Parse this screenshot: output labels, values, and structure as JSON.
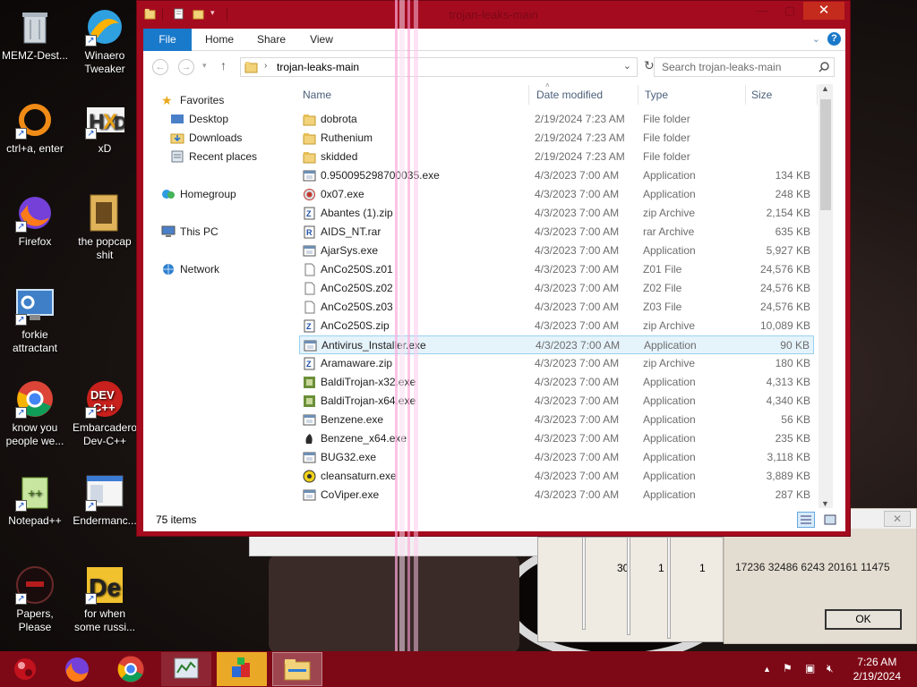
{
  "desktop": {
    "icons": [
      {
        "label": "MEMZ-Dest...",
        "icon": "recycle-bin-icon"
      },
      {
        "label": "Winaero Tweaker",
        "icon": "winaero-icon"
      },
      {
        "label": "ctrl+a, enter",
        "icon": "ring-icon"
      },
      {
        "label": "xD",
        "icon": "hxd-icon"
      },
      {
        "label": "Firefox",
        "icon": "firefox-icon"
      },
      {
        "label": "the popcap shit",
        "icon": "folder-icon"
      },
      {
        "label": "forkie attractant",
        "icon": "monitor-icon"
      },
      {
        "label": "know you people we...",
        "icon": "chrome-icon"
      },
      {
        "label": "Embarcadero Dev-C++",
        "icon": "devcpp-icon"
      },
      {
        "label": "Notepad++",
        "icon": "notepadpp-icon"
      },
      {
        "label": "Endermanc...",
        "icon": "window-icon"
      },
      {
        "label": "Papers, Please",
        "icon": "papers-please-icon"
      },
      {
        "label": "for when some russi...",
        "icon": "de-icon"
      }
    ]
  },
  "explorer": {
    "title": "trojan-leaks-main",
    "ribbon_tabs": [
      "File",
      "Home",
      "Share",
      "View"
    ],
    "address": "trojan-leaks-main",
    "search_placeholder": "Search trojan-leaks-main",
    "nav": {
      "favorites": "Favorites",
      "favorites_items": [
        "Desktop",
        "Downloads",
        "Recent places"
      ],
      "homegroup": "Homegroup",
      "this_pc": "This PC",
      "network": "Network"
    },
    "columns": {
      "name": "Name",
      "date": "Date modified",
      "type": "Type",
      "size": "Size"
    },
    "files": [
      {
        "name": "dobrota",
        "date": "2/19/2024 7:23 AM",
        "type": "File folder",
        "size": "",
        "icon": "folder-icon"
      },
      {
        "name": "Ruthenium",
        "date": "2/19/2024 7:23 AM",
        "type": "File folder",
        "size": "",
        "icon": "folder-icon"
      },
      {
        "name": "skidded",
        "date": "2/19/2024 7:23 AM",
        "type": "File folder",
        "size": "",
        "icon": "folder-icon"
      },
      {
        "name": "0.950095298700035.exe",
        "date": "4/3/2023 7:00 AM",
        "type": "Application",
        "size": "134 KB",
        "icon": "exe-icon"
      },
      {
        "name": "0x07.exe",
        "date": "4/3/2023 7:00 AM",
        "type": "Application",
        "size": "248 KB",
        "icon": "exe-red-icon"
      },
      {
        "name": "Abantes (1).zip",
        "date": "4/3/2023 7:00 AM",
        "type": "zip Archive",
        "size": "2,154 KB",
        "icon": "zip-icon"
      },
      {
        "name": "AIDS_NT.rar",
        "date": "4/3/2023 7:00 AM",
        "type": "rar Archive",
        "size": "635 KB",
        "icon": "rar-icon"
      },
      {
        "name": "AjarSys.exe",
        "date": "4/3/2023 7:00 AM",
        "type": "Application",
        "size": "5,927 KB",
        "icon": "exe-icon"
      },
      {
        "name": "AnCo250S.z01",
        "date": "4/3/2023 7:00 AM",
        "type": "Z01 File",
        "size": "24,576 KB",
        "icon": "blank-file-icon"
      },
      {
        "name": "AnCo250S.z02",
        "date": "4/3/2023 7:00 AM",
        "type": "Z02 File",
        "size": "24,576 KB",
        "icon": "blank-file-icon"
      },
      {
        "name": "AnCo250S.z03",
        "date": "4/3/2023 7:00 AM",
        "type": "Z03 File",
        "size": "24,576 KB",
        "icon": "blank-file-icon"
      },
      {
        "name": "AnCo250S.zip",
        "date": "4/3/2023 7:00 AM",
        "type": "zip Archive",
        "size": "10,089 KB",
        "icon": "zip-icon"
      },
      {
        "name": "Antivirus_Installer.exe",
        "date": "4/3/2023 7:00 AM",
        "type": "Application",
        "size": "90 KB",
        "icon": "exe-icon"
      },
      {
        "name": "Aramaware.zip",
        "date": "4/3/2023 7:00 AM",
        "type": "zip Archive",
        "size": "180 KB",
        "icon": "zip-icon"
      },
      {
        "name": "BaldiTrojan-x32.exe",
        "date": "4/3/2023 7:00 AM",
        "type": "Application",
        "size": "4,313 KB",
        "icon": "exe-green-icon"
      },
      {
        "name": "BaldiTrojan-x64.exe",
        "date": "4/3/2023 7:00 AM",
        "type": "Application",
        "size": "4,340 KB",
        "icon": "exe-green-icon"
      },
      {
        "name": "Benzene.exe",
        "date": "4/3/2023 7:00 AM",
        "type": "Application",
        "size": "56 KB",
        "icon": "exe-icon"
      },
      {
        "name": "Benzene_x64.exe",
        "date": "4/3/2023 7:00 AM",
        "type": "Application",
        "size": "235 KB",
        "icon": "exe-dark-icon"
      },
      {
        "name": "BUG32.exe",
        "date": "4/3/2023 7:00 AM",
        "type": "Application",
        "size": "3,118 KB",
        "icon": "exe-icon"
      },
      {
        "name": "cleansaturn.exe",
        "date": "4/3/2023 7:00 AM",
        "type": "Application",
        "size": "3,889 KB",
        "icon": "exe-yellow-icon"
      },
      {
        "name": "CoViper.exe",
        "date": "4/3/2023 7:00 AM",
        "type": "Application",
        "size": "287 KB",
        "icon": "exe-icon"
      }
    ],
    "selected_index": 12,
    "status": "75 items"
  },
  "dialog": {
    "numbers": "17236 32486 6243 20161 11475",
    "ok": "OK",
    "close": "✕"
  },
  "background_numbers": [
    "30",
    "1",
    "1"
  ],
  "taskbar": {
    "time": "7:26 AM",
    "date": "2/19/2024"
  },
  "colors": {
    "window_frame": "#a50b1f",
    "taskbar": "#7e0916",
    "file_tab": "#1979ca",
    "close_button": "#c42b1c",
    "selection": "#e5f3fb"
  }
}
